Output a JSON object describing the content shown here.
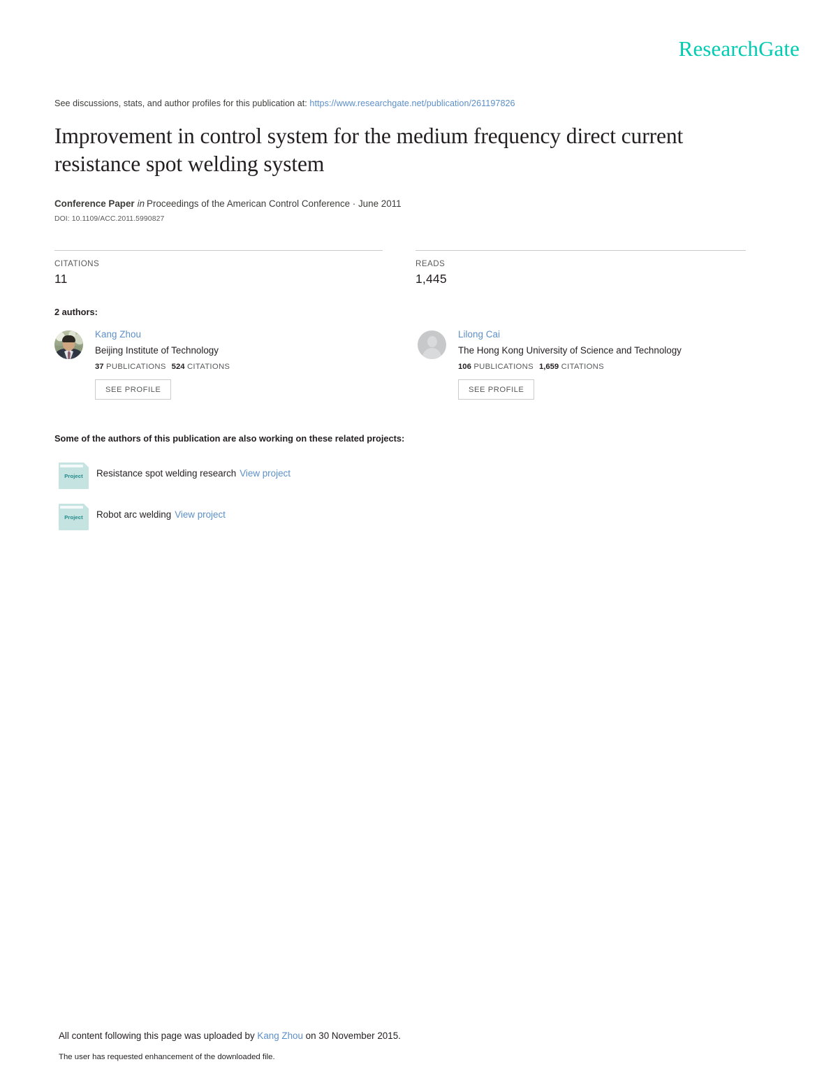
{
  "brand": {
    "name": "ResearchGate",
    "color": "#00ccb2"
  },
  "discussions": {
    "prefix": "See discussions, stats, and author profiles for this publication at:",
    "url": "https://www.researchgate.net/publication/261197826"
  },
  "paper": {
    "title": "Improvement in control system for the medium frequency direct current resistance spot welding system",
    "type": "Conference Paper",
    "in_word": "in",
    "venue": "Proceedings of the American Control Conference · June 2011",
    "doi": "DOI: 10.1109/ACC.2011.5990827"
  },
  "stats": [
    {
      "label": "CITATIONS",
      "value": "11"
    },
    {
      "label": "READS",
      "value": "1,445"
    }
  ],
  "authors_section": {
    "heading": "2 authors:",
    "see_profile_label": "SEE PROFILE",
    "publications_label": "PUBLICATIONS",
    "citations_label": "CITATIONS",
    "authors": [
      {
        "name": "Kang Zhou",
        "affiliation": "Beijing Institute of Technology",
        "publications": "37",
        "citations": "524",
        "avatar": "photo-avatar"
      },
      {
        "name": "Lilong Cai",
        "affiliation": "The Hong Kong University of Science and Technology",
        "publications": "106",
        "citations": "1,659",
        "avatar": "placeholder-avatar"
      }
    ]
  },
  "projects_section": {
    "heading": "Some of the authors of this publication are also working on these related projects:",
    "folder_label": "Project",
    "view_label": "View project",
    "projects": [
      {
        "title": "Resistance spot welding research"
      },
      {
        "title": "Robot arc welding"
      }
    ]
  },
  "footer": {
    "upload_prefix": "All content following this page was uploaded by",
    "uploader": "Kang Zhou",
    "upload_suffix": "on 30 November 2015.",
    "enhancement_note": "The user has requested enhancement of the downloaded file."
  },
  "colors": {
    "link": "#5c8fc8",
    "brand": "#00ccb2",
    "folder": "#c5e3e1",
    "rule": "#c9cacb"
  }
}
